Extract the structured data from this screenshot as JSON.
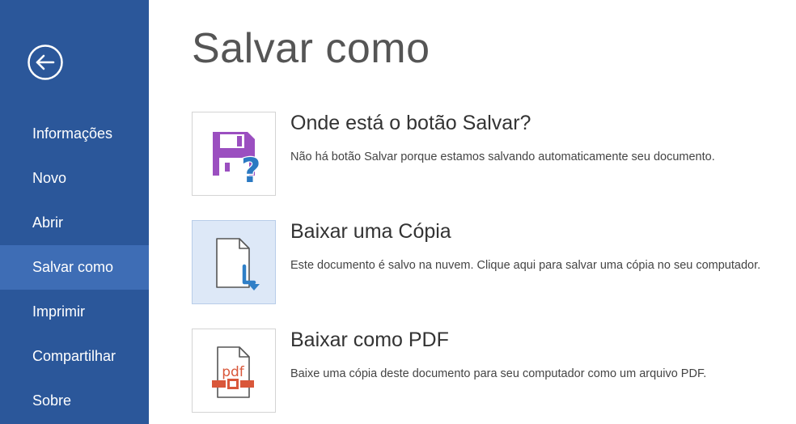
{
  "sidebar": {
    "back_icon": "back-arrow-circle-icon",
    "items": [
      {
        "label": "Informações",
        "active": false
      },
      {
        "label": "Novo",
        "active": false
      },
      {
        "label": "Abrir",
        "active": false
      },
      {
        "label": "Salvar como",
        "active": true
      },
      {
        "label": "Imprimir",
        "active": false
      },
      {
        "label": "Compartilhar",
        "active": false
      },
      {
        "label": "Sobre",
        "active": false
      }
    ]
  },
  "main": {
    "title": "Salvar como",
    "options": [
      {
        "icon": "save-question-icon",
        "title": "Onde está o botão Salvar?",
        "description": "Não há botão Salvar porque estamos salvando automaticamente seu documento."
      },
      {
        "icon": "download-copy-icon",
        "title": "Baixar uma Cópia",
        "description": "Este documento é salvo na nuvem. Clique aqui para salvar uma cópia no seu computador."
      },
      {
        "icon": "pdf-file-icon",
        "title": "Baixar como PDF",
        "description": "Baixe uma cópia deste documento para seu computador como um arquivo PDF.",
        "icon_text": "pdf"
      }
    ]
  },
  "colors": {
    "sidebar_bg": "#2b579a",
    "sidebar_active": "#3e6db5",
    "save_icon": "#9b4fc0",
    "question_mark": "#2b79c2",
    "download_arrow": "#2f7fc7",
    "pdf_red": "#d9573a"
  }
}
